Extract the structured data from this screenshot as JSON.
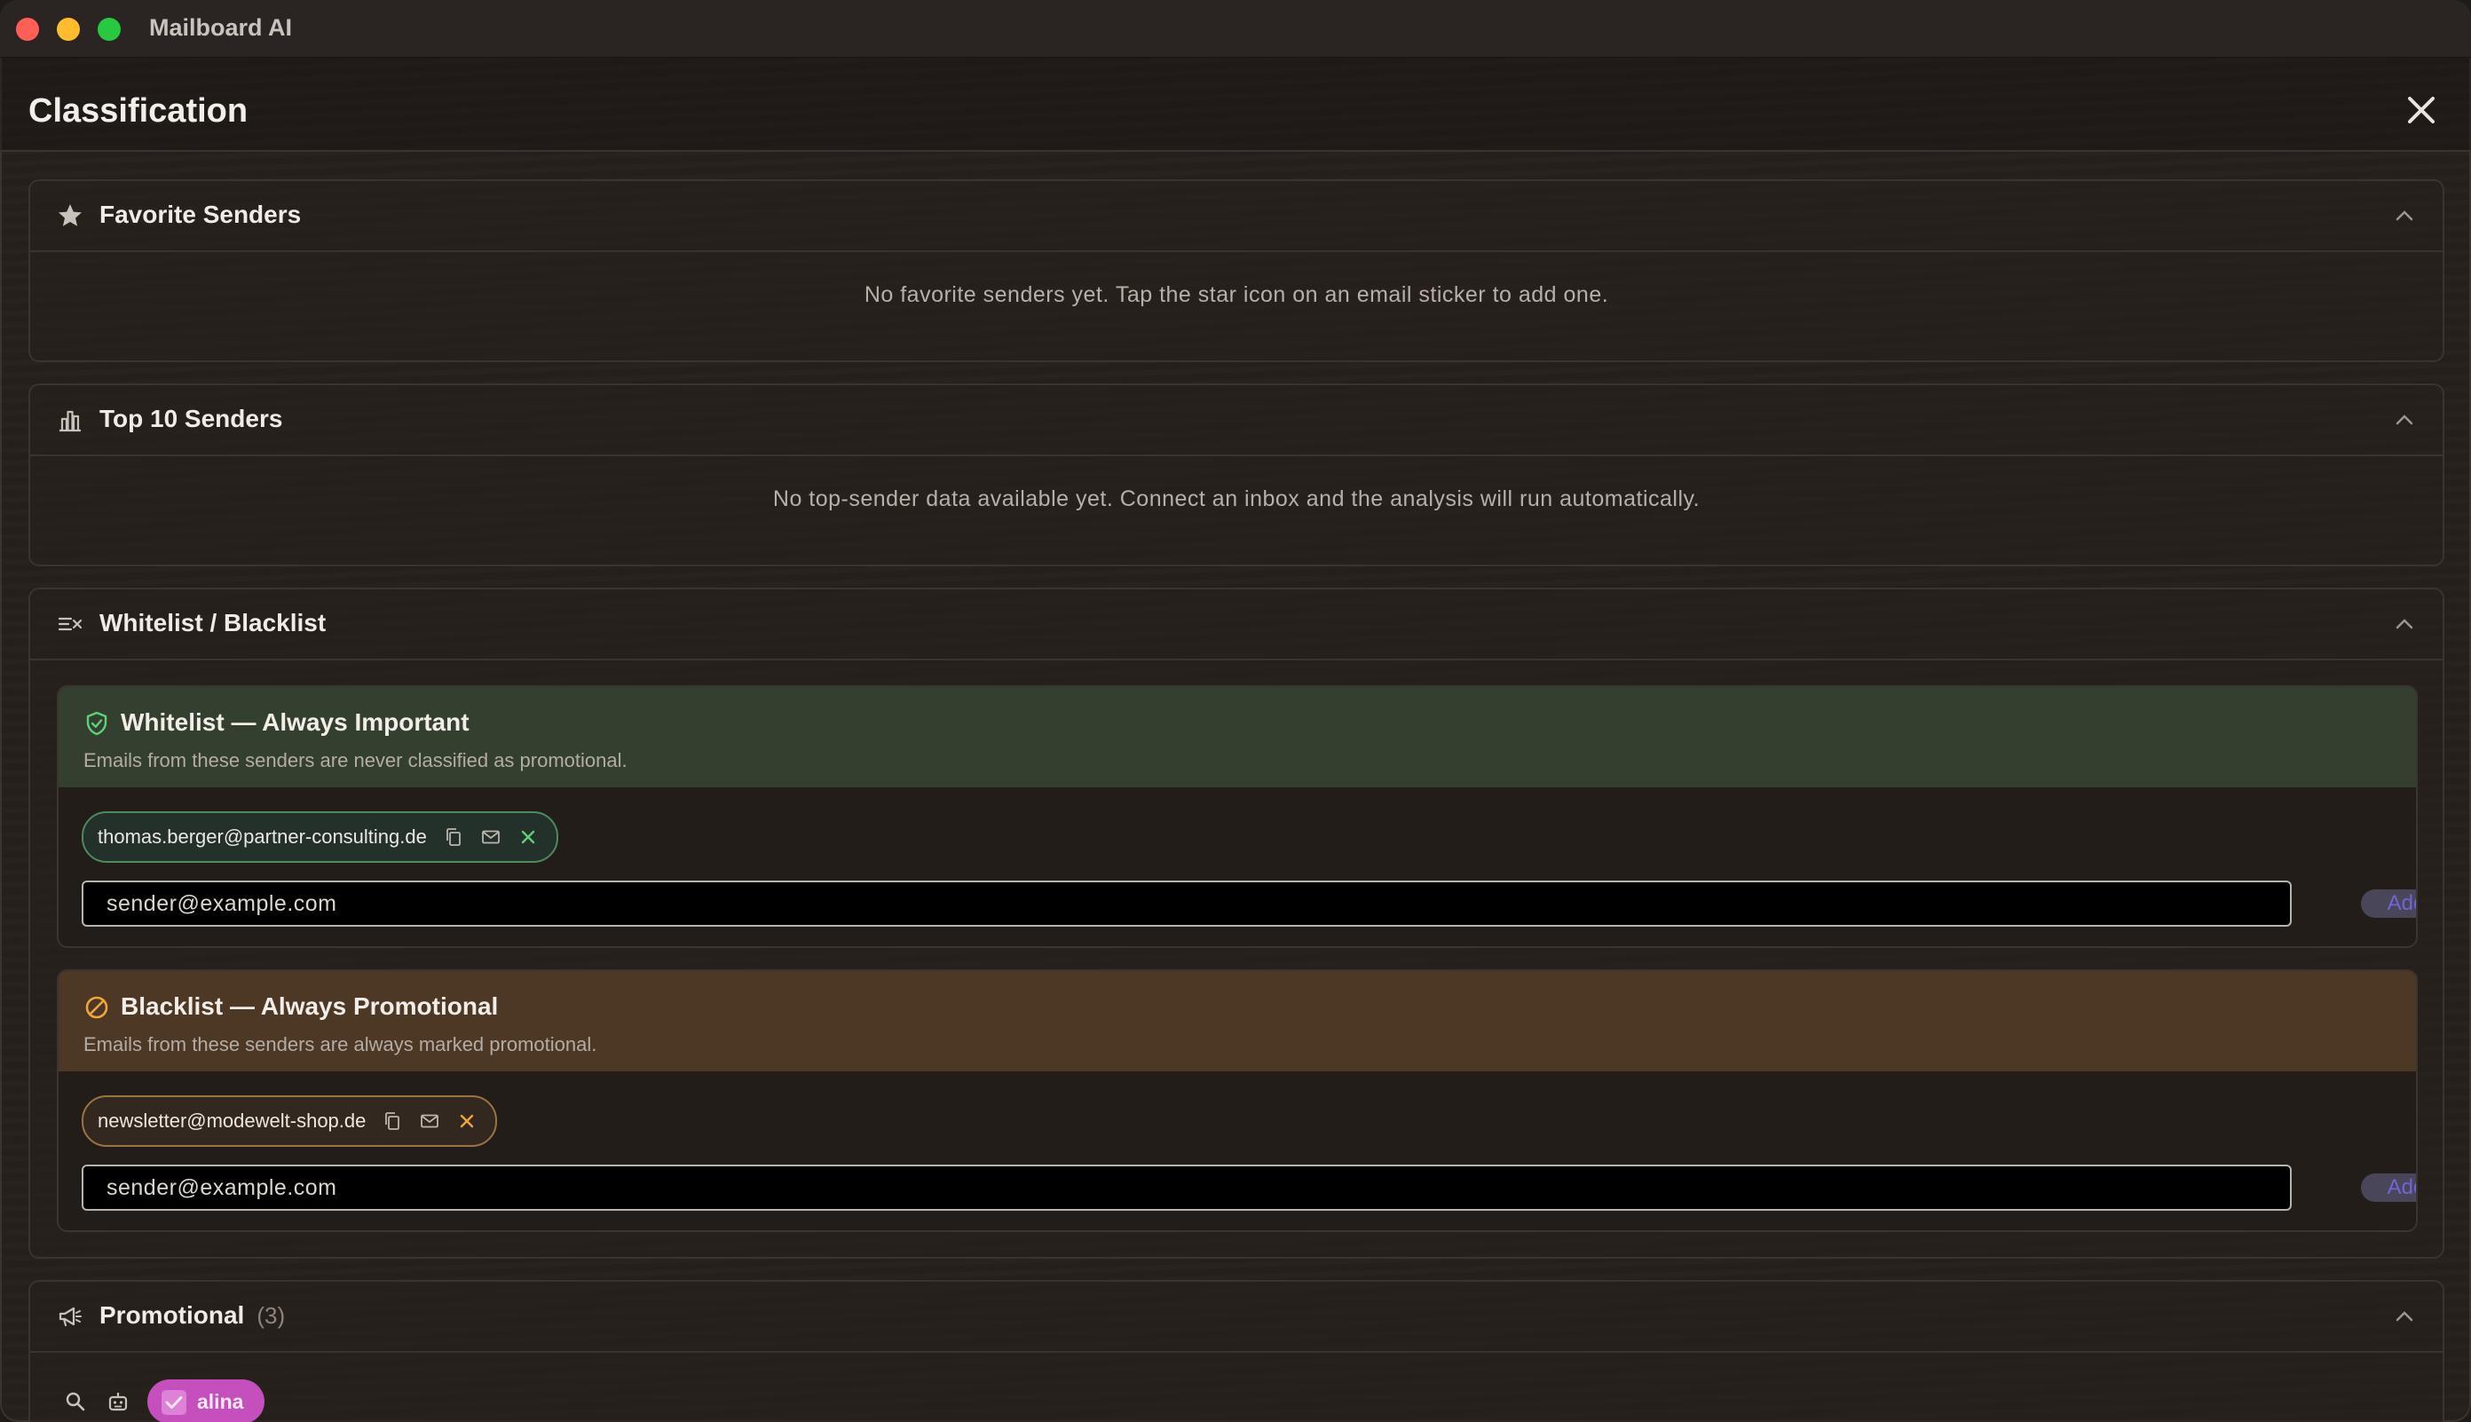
{
  "window": {
    "app_title": "Mailboard AI"
  },
  "header": {
    "title": "Classification"
  },
  "favorites": {
    "title": "Favorite Senders",
    "empty_text": "No favorite senders yet. Tap the star icon on an email sticker to add one."
  },
  "top_senders": {
    "title": "Top 10 Senders",
    "empty_text": "No top-sender data available yet. Connect an inbox and the analysis will run automatically."
  },
  "lists": {
    "title": "Whitelist / Blacklist",
    "whitelist": {
      "title": "Whitelist — Always Important",
      "description": "Emails from these senders are never classified as promotional.",
      "entries": [
        "thomas.berger@partner-consulting.de"
      ],
      "input_placeholder": "sender@example.com",
      "add_label": "Add",
      "accent_color": "#5fcf7a"
    },
    "blacklist": {
      "title": "Blacklist — Always Promotional",
      "description": "Emails from these senders are always marked promotional.",
      "entries": [
        "newsletter@modewelt-shop.de"
      ],
      "input_placeholder": "sender@example.com",
      "add_label": "Add",
      "accent_color": "#f0a63a"
    }
  },
  "promotional": {
    "title": "Promotional",
    "count": "(3)"
  },
  "bottom_bar": {
    "user_name": "alina"
  }
}
